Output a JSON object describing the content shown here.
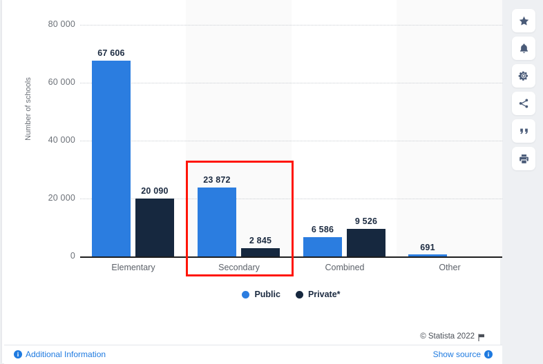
{
  "chart_data": {
    "type": "bar",
    "title": "",
    "xlabel": "",
    "ylabel": "Number of schools",
    "ylim": [
      0,
      80000
    ],
    "yticks": [
      "0",
      "20 000",
      "40 000",
      "60 000",
      "80 000"
    ],
    "ytick_values": [
      0,
      20000,
      40000,
      60000,
      80000
    ],
    "grid": true,
    "legend_position": "bottom",
    "categories": [
      "Elementary",
      "Secondary",
      "Combined",
      "Other"
    ],
    "series": [
      {
        "name": "Public",
        "color": "#2b7de0",
        "values": [
          67606,
          23872,
          6586,
          691
        ],
        "labels": [
          "67 606",
          "23 872",
          "6 586",
          "691"
        ]
      },
      {
        "name": "Private*",
        "color": "#16283f",
        "values": [
          20090,
          2845,
          9526,
          null
        ],
        "labels": [
          "20 090",
          "2 845",
          "9 526",
          ""
        ]
      }
    ],
    "annotation": {
      "type": "rectangle-highlight",
      "target_category": "Secondary",
      "color": "#ff1505"
    }
  },
  "legend": [
    {
      "label": "Public",
      "color": "#2b7de0",
      "dot": "legend-dot-public"
    },
    {
      "label": "Private*",
      "color": "#16283f",
      "dot": "legend-dot-private"
    }
  ],
  "footer": {
    "copyright": "© Statista 2022",
    "flag_icon": "flag-icon",
    "additional_information": "Additional Information",
    "show_source": "Show source",
    "info_icon": "i"
  },
  "toolbar": [
    {
      "name": "favorite-button",
      "icon": "star-icon"
    },
    {
      "name": "alert-button",
      "icon": "bell-icon"
    },
    {
      "name": "settings-button",
      "icon": "gear-icon"
    },
    {
      "name": "share-button",
      "icon": "share-icon"
    },
    {
      "name": "cite-button",
      "icon": "quote-icon"
    },
    {
      "name": "print-button",
      "icon": "print-icon"
    }
  ]
}
